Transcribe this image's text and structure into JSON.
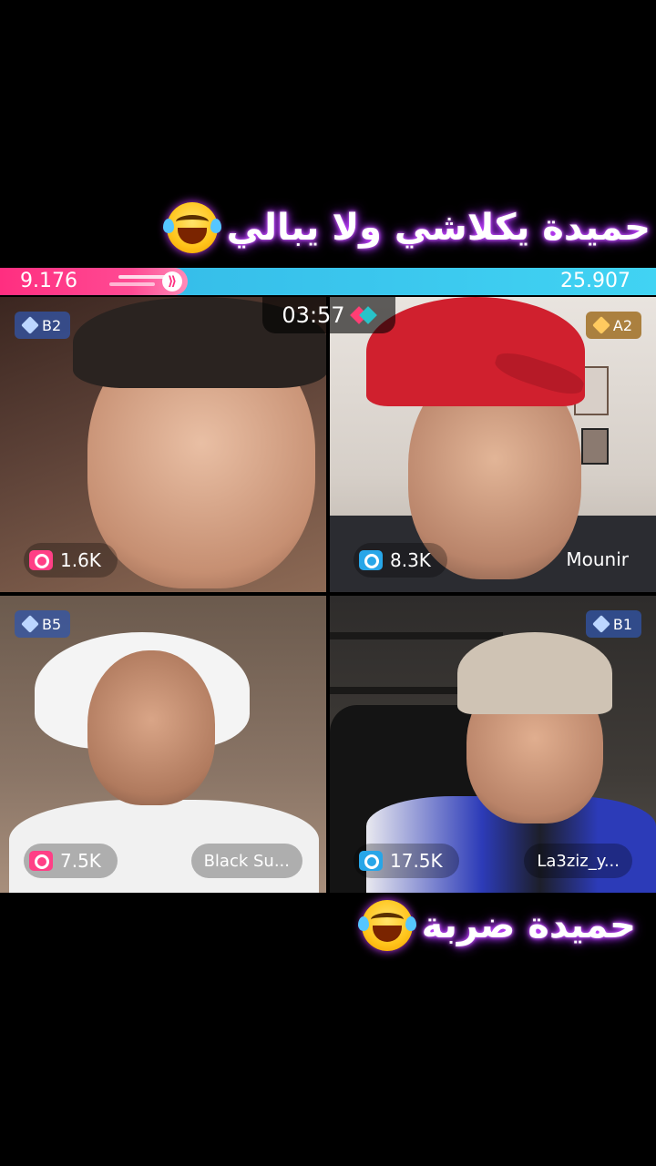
{
  "captions": {
    "top": "حميدة يكلاشي ولا يبالي",
    "bottom": "حميدة ضربة",
    "emoji_icon": "tears-of-joy-emoji"
  },
  "battle": {
    "left_score": "9.176",
    "right_score": "25.907",
    "timer": "03:57",
    "left_color": "#ff2e80",
    "right_color": "#32b6e6"
  },
  "tiles": [
    {
      "rank": "B2",
      "rank_style": "blue",
      "likes": "1.6K",
      "likes_color": "pink",
      "name": ""
    },
    {
      "rank": "A2",
      "rank_style": "gold",
      "likes": "8.3K",
      "likes_color": "blue",
      "name": "Mounir"
    },
    {
      "rank": "B5",
      "rank_style": "blue",
      "likes": "7.5K",
      "likes_color": "pink",
      "name": "Black Su..."
    },
    {
      "rank": "B1",
      "rank_style": "blue",
      "likes": "17.5K",
      "likes_color": "blue",
      "name": "La3ziz_y..."
    }
  ]
}
